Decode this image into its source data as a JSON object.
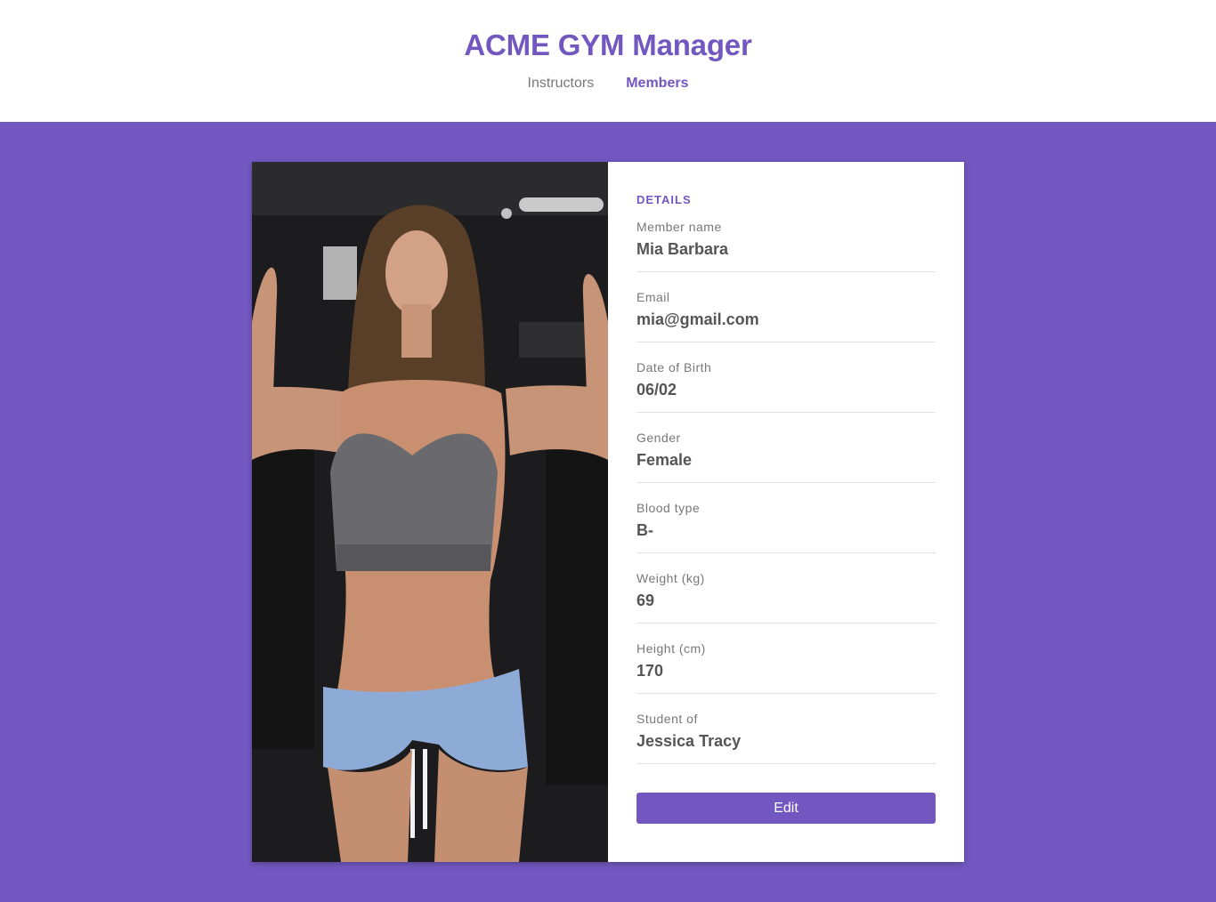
{
  "header": {
    "title": "ACME GYM Manager",
    "nav": [
      {
        "label": "Instructors",
        "active": false
      },
      {
        "label": "Members",
        "active": true
      }
    ]
  },
  "member": {
    "photo_alt": "Mia Barbara",
    "section_title": "DETAILS",
    "fields": [
      {
        "label": "Member name",
        "value": "Mia Barbara"
      },
      {
        "label": "Email",
        "value": "mia@gmail.com"
      },
      {
        "label": "Date of Birth",
        "value": "06/02"
      },
      {
        "label": "Gender",
        "value": "Female"
      },
      {
        "label": "Blood type",
        "value": "B-"
      },
      {
        "label": "Weight (kg)",
        "value": "69"
      },
      {
        "label": "Height (cm)",
        "value": "170"
      },
      {
        "label": "Student of",
        "value": "Jessica Tracy"
      }
    ],
    "edit_label": "Edit"
  },
  "colors": {
    "accent": "#7257c0",
    "background": "#7257c0",
    "surface": "#ffffff"
  }
}
